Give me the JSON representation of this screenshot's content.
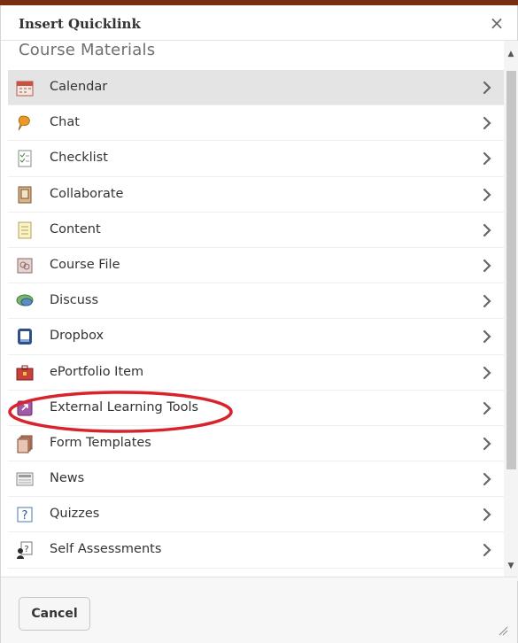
{
  "dialog": {
    "title": "Insert Quicklink",
    "close_label": "×",
    "section_title": "Course Materials",
    "cancel_label": "Cancel"
  },
  "items": [
    {
      "label": "Calendar",
      "icon": "calendar-icon",
      "selected": true
    },
    {
      "label": "Chat",
      "icon": "chat-icon"
    },
    {
      "label": "Checklist",
      "icon": "checklist-icon"
    },
    {
      "label": "Collaborate",
      "icon": "collaborate-icon"
    },
    {
      "label": "Content",
      "icon": "content-icon"
    },
    {
      "label": "Course File",
      "icon": "course-file-icon"
    },
    {
      "label": "Discuss",
      "icon": "discuss-icon"
    },
    {
      "label": "Dropbox",
      "icon": "dropbox-icon"
    },
    {
      "label": "ePortfolio Item",
      "icon": "eportfolio-icon"
    },
    {
      "label": "External Learning Tools",
      "icon": "external-tools-icon",
      "highlighted": true
    },
    {
      "label": "Form Templates",
      "icon": "form-templates-icon"
    },
    {
      "label": "News",
      "icon": "news-icon"
    },
    {
      "label": "Quizzes",
      "icon": "quizzes-icon"
    },
    {
      "label": "Self Assessments",
      "icon": "self-assessments-icon"
    }
  ],
  "colors": {
    "selected_row": "#e4e4e4",
    "highlight_ellipse": "#d8232a",
    "header_strip": "#7a2e12"
  }
}
